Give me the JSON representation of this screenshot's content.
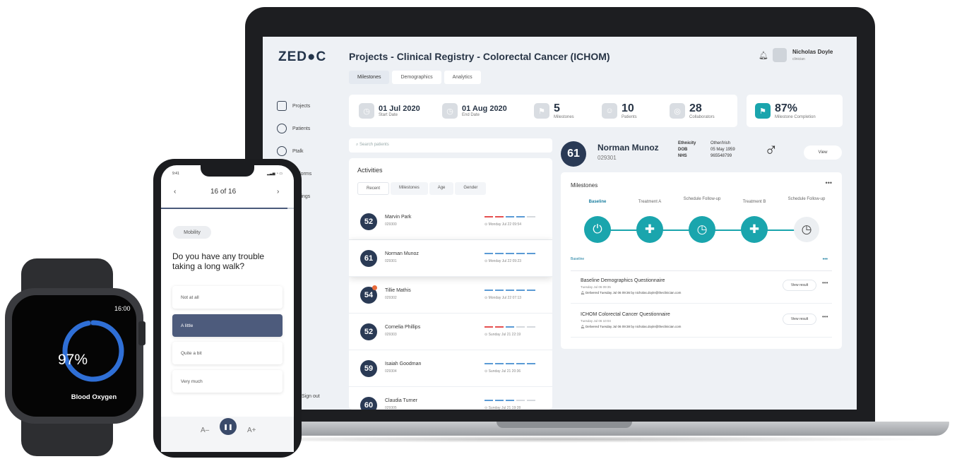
{
  "app": {
    "logo": "ZED●C",
    "title": "Projects - Clinical Registry - Colorectal Cancer (ICHOM)",
    "tabs": [
      "Milestones",
      "Demographics",
      "Analytics"
    ],
    "user": {
      "name": "Nicholas Doyle",
      "role": "clinician"
    }
  },
  "sidebar": {
    "items": [
      "Projects",
      "Patients",
      "Ptalk",
      "All forms",
      "Settings"
    ],
    "sign_out": "Sign out"
  },
  "stats": {
    "start": {
      "value": "01 Jul 2020",
      "label": "Start Date"
    },
    "end": {
      "value": "01 Aug 2020",
      "label": "End Date"
    },
    "milestones": {
      "value": "5",
      "label": "Milestones"
    },
    "patients": {
      "value": "10",
      "label": "Patients"
    },
    "collaborators": {
      "value": "28",
      "label": "Collaborators"
    },
    "completion": {
      "value": "87%",
      "label": "Milestone Completion"
    }
  },
  "search": {
    "placeholder": "Search patients"
  },
  "activities": {
    "title": "Activities",
    "tabs": [
      "Recent",
      "Milestones",
      "Age",
      "Gender"
    ],
    "rows": [
      {
        "num": "52",
        "name": "Marvin Park",
        "id": "029300",
        "time": "Monday Jul 22 09:54"
      },
      {
        "num": "61",
        "name": "Norman Munoz",
        "id": "029301",
        "time": "Monday Jul 22 09:23"
      },
      {
        "num": "54",
        "name": "Tillie Mathis",
        "id": "029302",
        "time": "Monday Jul 22 07:13"
      },
      {
        "num": "52",
        "name": "Cornelia Phillips",
        "id": "029303",
        "time": "Sunday Jul 21 22:19"
      },
      {
        "num": "59",
        "name": "Isaiah Goodman",
        "id": "029304",
        "time": "Sunday Jul 21 20:36"
      },
      {
        "num": "60",
        "name": "Claudia Turner",
        "id": "029305",
        "time": "Sunday Jul 21 19:28"
      }
    ]
  },
  "patient": {
    "num": "61",
    "name": "Norman Munoz",
    "id": "029301",
    "ethnicity_label": "Ethnicity",
    "ethnicity": "Other/Irish",
    "dob_label": "DOB",
    "dob": "05 May 1959",
    "nhs_label": "NHS",
    "nhs": "965548799",
    "gender_symbol": "♂",
    "view": "View"
  },
  "milestones": {
    "title": "Milestones",
    "steps": [
      {
        "label": "Baseline",
        "icon": "power-icon",
        "done": true
      },
      {
        "label": "Treatment A",
        "icon": "plus-icon",
        "done": true
      },
      {
        "label": "Schedule Follow-up",
        "icon": "clock-icon",
        "done": true
      },
      {
        "label": "Treatment B",
        "icon": "plus-icon",
        "done": true
      },
      {
        "label": "Schedule Follow-up",
        "icon": "clock-icon",
        "done": false
      }
    ],
    "section": "Baseline",
    "questionnaires": [
      {
        "title": "Baseline Demographics Questionnaire",
        "date": "Tuesday Jul 06 09:35",
        "delivered": "Delivered Tuesday Jul 06 09:36 by nicholas.doyle@theclinician.com",
        "button": "View result"
      },
      {
        "title": "ICHOM Colorectal Cancer Questionnaire",
        "date": "Tuesday Jul 06 10:04",
        "delivered": "Delivered Tuesday Jul 06 09:38 by nicholas.doyle@theclinician.com",
        "button": "View result"
      }
    ]
  },
  "phone": {
    "time": "9:41",
    "counter": "16 of 16",
    "progress": 1.0,
    "chip": "Mobility",
    "question": "Do you have any trouble taking a long walk?",
    "options": [
      "Not at all",
      "A little",
      "Quite a bit",
      "Very much"
    ],
    "selected": 1,
    "a_minus": "A–",
    "a_plus": "A+"
  },
  "watch": {
    "time": "16:00",
    "percent": "97%",
    "percent_value": 0.97,
    "label": "Blood Oxygen",
    "ring_color": "#2f6fd6"
  },
  "colors": {
    "accent": "#1aa5ad",
    "navy": "#2a3a55",
    "alert": "#e86a3a"
  }
}
